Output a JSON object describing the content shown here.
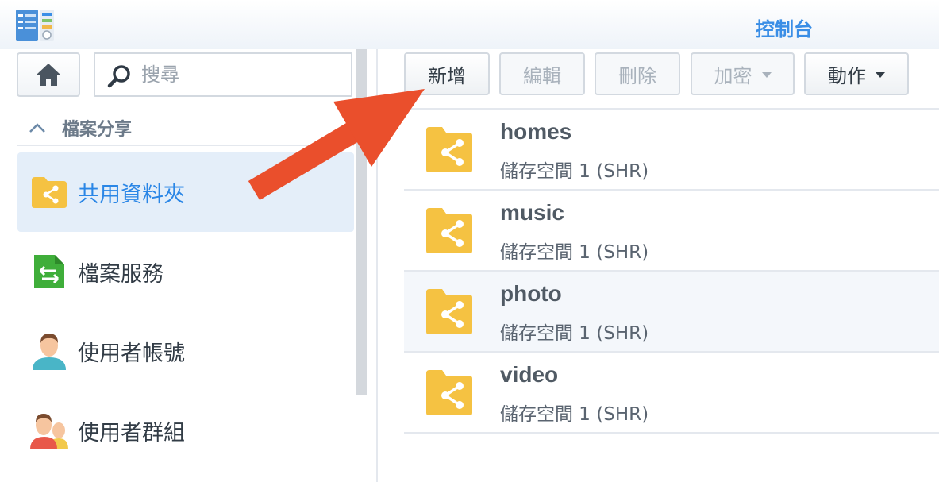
{
  "window": {
    "title": "控制台"
  },
  "sidebar": {
    "search_placeholder": "搜尋",
    "section_label": "檔案分享",
    "items": [
      {
        "label": "共用資料夾",
        "icon": "shared-folder-icon",
        "active": true
      },
      {
        "label": "檔案服務",
        "icon": "file-services-icon",
        "active": false
      },
      {
        "label": "使用者帳號",
        "icon": "user-icon",
        "active": false
      },
      {
        "label": "使用者群組",
        "icon": "user-group-icon",
        "active": false
      }
    ]
  },
  "toolbar": {
    "create_label": "新增",
    "edit_label": "編輯",
    "delete_label": "刪除",
    "encrypt_label": "加密",
    "action_label": "動作"
  },
  "folders": [
    {
      "name": "homes",
      "location": "儲存空間 1 (SHR)"
    },
    {
      "name": "music",
      "location": "儲存空間 1 (SHR)"
    },
    {
      "name": "photo",
      "location": "儲存空間 1 (SHR)"
    },
    {
      "name": "video",
      "location": "儲存空間 1 (SHR)"
    }
  ],
  "colors": {
    "accent": "#2a86e6",
    "folder": "#f5c242",
    "arrow": "#ea4f2c"
  }
}
